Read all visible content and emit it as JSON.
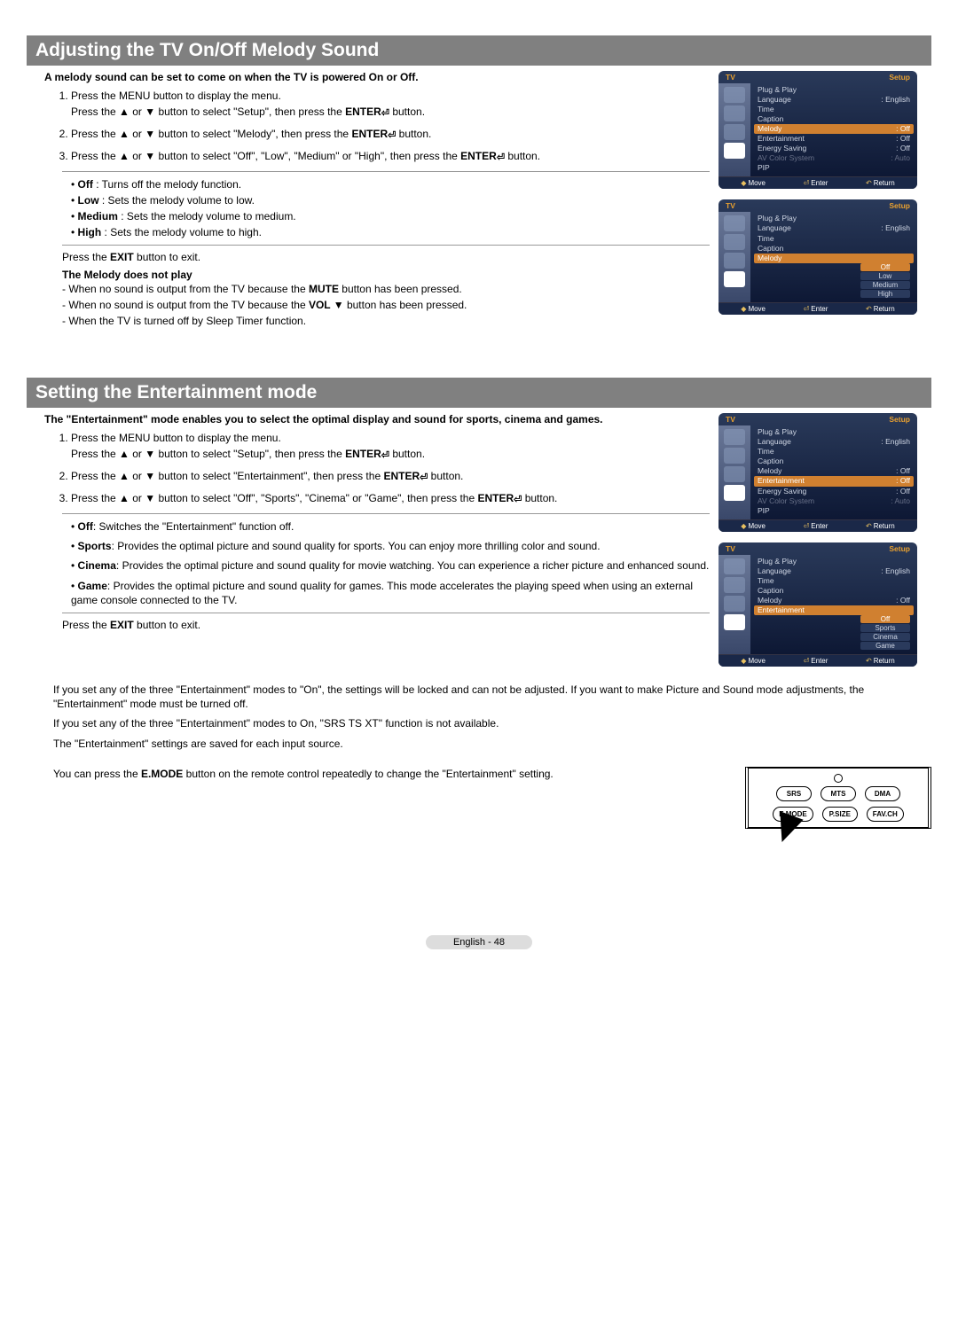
{
  "section1": {
    "title": "Adjusting the TV On/Off Melody Sound",
    "intro": "A melody sound can be set to come on when the TV is powered On or Off.",
    "step1": "Press the MENU button to display the menu.",
    "step1b_a": "Press the ▲ or ▼ button to select \"Setup\", then press the ",
    "step1b_b": " button.",
    "step2_a": "Press the ▲ or ▼ button to select \"Melody\", then press the ",
    "step2_b": " button.",
    "step3_a": "Press the ▲ or ▼ button to select \"Off\", \"Low\", \"Medium\" or \"High\", then press the ",
    "step3_b": " button.",
    "b_off": "Off : Turns off the melody function.",
    "b_low": "Low : Sets the melody volume to low.",
    "b_med": "Medium : Sets the melody volume to medium.",
    "b_high": "High : Sets the melody volume to high.",
    "exit": "Press the EXIT button to exit.",
    "note_title": "The Melody does not play",
    "note1": "When no sound is output from the TV because the MUTE button has been pressed.",
    "note2": "When no sound is output from the TV because the VOL ▼ button has been pressed.",
    "note3": "When the TV is turned off by Sleep Timer function."
  },
  "section2": {
    "title": "Setting the Entertainment mode",
    "intro": "The \"Entertainment\" mode enables you to select the optimal display and sound for sports, cinema and games.",
    "step1": "Press the MENU button to display the menu.",
    "step1b_a": "Press the ▲ or ▼ button to select \"Setup\", then press the ",
    "step1b_b": " button.",
    "step2_a": "Press the ▲ or ▼ button to select \"Entertainment\", then press the ",
    "step2_b": " button.",
    "step3_a": "Press the ▲ or ▼ button to select \"Off\", \"Sports\", \"Cinema\" or \"Game\", then press the ",
    "step3_b": " button.",
    "b_off_l": "Off",
    "b_off_t": ": Switches the \"Entertainment\" function off.",
    "b_sports_l": "Sports",
    "b_sports_t": ": Provides the optimal picture and sound quality for sports. You can enjoy more thrilling color and sound.",
    "b_cinema_l": "Cinema",
    "b_cinema_t": ": Provides the optimal picture and sound quality for movie watching. You can experience a richer picture and enhanced sound.",
    "b_game_l": "Game",
    "b_game_t": ": Provides the optimal picture and sound quality for games. This mode accelerates the playing speed when using an external game console connected to the TV.",
    "exit": "Press the EXIT button to exit.",
    "para1": "If you set any of the three \"Entertainment\" modes to \"On\", the settings will be locked and can not be adjusted. If you want to make Picture and Sound mode adjustments, the \"Entertainment\" mode must be turned off.",
    "para2": "If you set any of the three \"Entertainment\" modes to On, \"SRS TS XT\" function is not available.",
    "para3": "The \"Entertainment\" settings are saved for each input source.",
    "para4": "You can press the E.MODE button on the remote control repeatedly to change the \"Entertainment\" setting."
  },
  "enter_label": "ENTER",
  "osd": {
    "tv": "TV",
    "setup": "Setup",
    "side": {
      "picture": "Picture",
      "sound": "Sound",
      "channel": "Channel",
      "setup": "Setup"
    },
    "items": {
      "plug": "Plug & Play",
      "language": "Language",
      "language_v": ": English",
      "time": "Time",
      "caption": "Caption",
      "melody": "Melody",
      "off": ": Off",
      "entertainment": "Entertainment",
      "energy": "Energy Saving",
      "avcolor": "AV Color System",
      "auto": ": Auto",
      "pip": "PIP"
    },
    "melody_opts": {
      "off": "Off",
      "low": "Low",
      "medium": "Medium",
      "high": "High"
    },
    "ent_opts": {
      "off": "Off",
      "sports": "Sports",
      "cinema": "Cinema",
      "game": "Game"
    },
    "foot": {
      "move": "Move",
      "enter": "Enter",
      "return": "Return"
    }
  },
  "remote": {
    "srs": "SRS",
    "mts": "MTS",
    "dma": "DMA",
    "emode": "E.MODE",
    "psize": "P.SIZE",
    "favch": "FAV.CH"
  },
  "footer": "English - 48"
}
